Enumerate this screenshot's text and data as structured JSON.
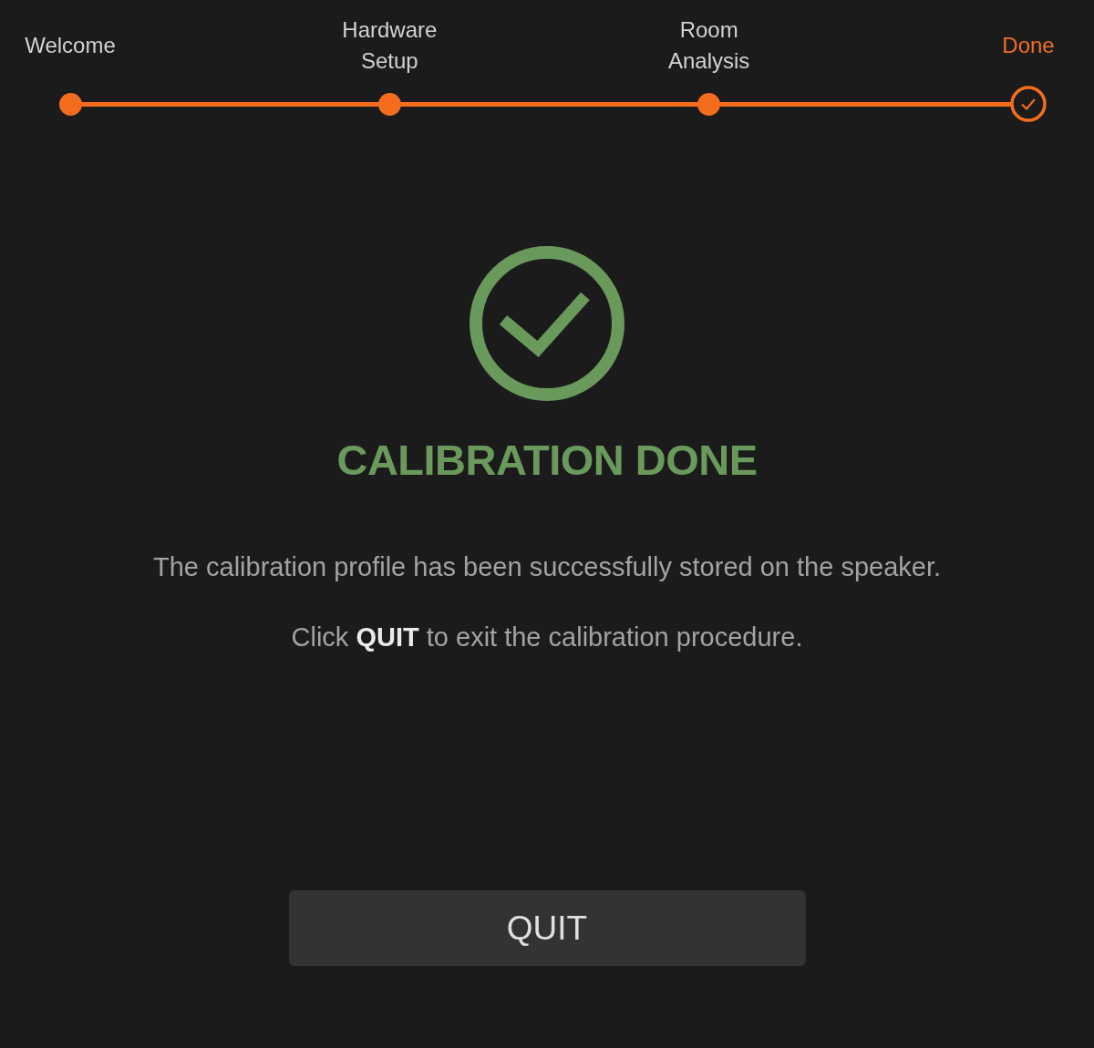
{
  "steps": [
    {
      "label": "Welcome",
      "selected": false
    },
    {
      "label": "Hardware Setup",
      "selected": false
    },
    {
      "label": "Room Analysis",
      "selected": false
    },
    {
      "label": "Done",
      "selected": true
    }
  ],
  "result": {
    "title": "CALIBRATION DONE",
    "messages": [
      "The calibration profile has been successfully stored on the speaker.",
      "Click **QUIT** to exit the calibration procedure."
    ]
  },
  "button": {
    "label": "QUIT"
  }
}
